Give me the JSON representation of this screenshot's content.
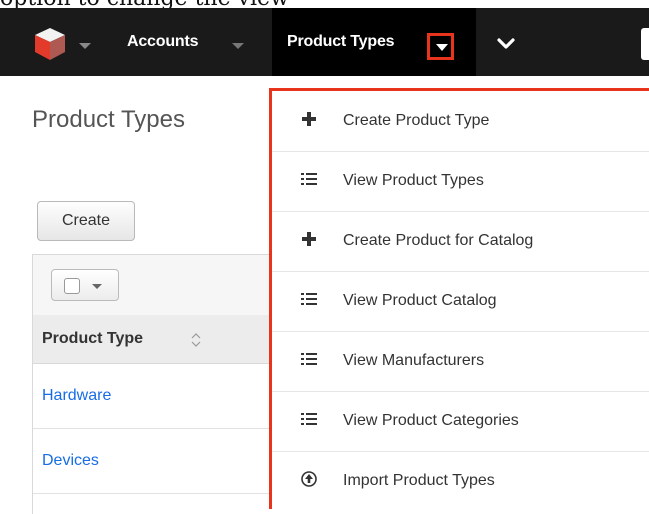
{
  "caption": {
    "partial_text": "option to change the view"
  },
  "navbar": {
    "logo_icon": "cube-logo-icon",
    "accounts_label": "Accounts",
    "product_types_label": "Product Types",
    "more_icon": "chevron-down-icon",
    "highlight_color": "#e8341c"
  },
  "page": {
    "title": "Product Types",
    "create_label": "Create"
  },
  "table": {
    "column_header": "Product Type",
    "rows": [
      {
        "name": "Hardware"
      },
      {
        "name": "Devices"
      }
    ],
    "link_color": "#176de5"
  },
  "menu": {
    "items": [
      {
        "label": "Create Product Type",
        "icon": "plus-icon"
      },
      {
        "label": "View Product Types",
        "icon": "list-icon"
      },
      {
        "label": "Create Product for Catalog",
        "icon": "plus-icon"
      },
      {
        "label": "View Product Catalog",
        "icon": "list-icon"
      },
      {
        "label": "View Manufacturers",
        "icon": "list-icon"
      },
      {
        "label": "View Product Categories",
        "icon": "list-icon"
      },
      {
        "label": "Import Product Types",
        "icon": "upload-icon"
      }
    ]
  }
}
